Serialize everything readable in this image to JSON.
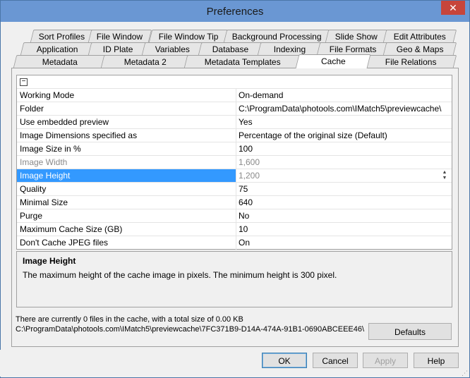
{
  "window": {
    "title": "Preferences",
    "close_label": "✕"
  },
  "tabs": {
    "row1": [
      "Sort Profiles",
      "File Window",
      "File Window Tip",
      "Background Processing",
      "Slide Show",
      "Edit Attributes"
    ],
    "row2": [
      "Application",
      "ID Plate",
      "Variables",
      "Database",
      "Indexing",
      "File Formats",
      "Geo & Maps"
    ],
    "row3": [
      "Metadata",
      "Metadata 2",
      "Metadata Templates",
      "Cache",
      "File Relations"
    ],
    "active": "Cache"
  },
  "grid": {
    "collapse_symbol": "−",
    "rows": [
      {
        "name": "Working Mode",
        "value": "On-demand"
      },
      {
        "name": "Folder",
        "value": "C:\\ProgramData\\photools.com\\IMatch5\\previewcache\\"
      },
      {
        "name": "Use embedded preview",
        "value": "Yes"
      },
      {
        "name": "Image Dimensions specified as",
        "value": "Percentage of the original size (Default)"
      },
      {
        "name": "Image Size in %",
        "value": "100"
      },
      {
        "name": "Image Width",
        "value": "1,600"
      },
      {
        "name": "Image Height",
        "value": "1,200"
      },
      {
        "name": "Quality",
        "value": "75"
      },
      {
        "name": "Minimal Size",
        "value": "640"
      },
      {
        "name": "Purge",
        "value": "No"
      },
      {
        "name": "Maximum Cache Size (GB)",
        "value": "10"
      },
      {
        "name": "Don't Cache JPEG files",
        "value": "On"
      }
    ],
    "selected_row": "Image Height",
    "spin_up": "▲",
    "spin_down": "▼"
  },
  "description": {
    "heading": "Image Height",
    "text": "The maximum height of the cache image in pixels. The minimum height is 300 pixel."
  },
  "status": {
    "line1": "There are currently 0 files in the cache, with a total size of 0.00 KB",
    "line2": "C:\\ProgramData\\photools.com\\IMatch5\\previewcache\\7FC371B9-D14A-474A-91B1-0690ABCEEE46\\"
  },
  "buttons": {
    "defaults": "Defaults",
    "ok": "OK",
    "cancel": "Cancel",
    "apply": "Apply",
    "help": "Help"
  }
}
